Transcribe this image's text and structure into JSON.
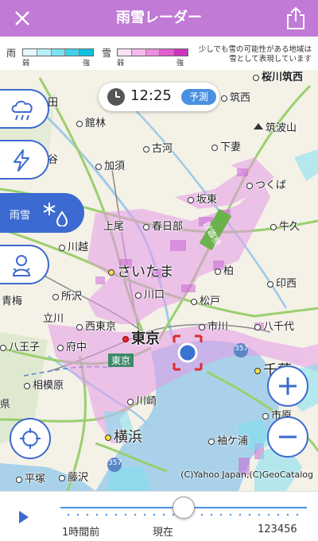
{
  "header": {
    "title": "雨雪レーダー",
    "close_icon": "close-icon",
    "share_icon": "share-icon"
  },
  "legend": {
    "rain_label": "雨",
    "snow_label": "雪",
    "weak": "弱",
    "strong": "強",
    "rain_colors": [
      "#e6f8fc",
      "#b8eef7",
      "#7fe0f0",
      "#3fd0e8",
      "#10c0de"
    ],
    "snow_colors": [
      "#fbe1f4",
      "#f5b8ea",
      "#ec8ede",
      "#de5fcf",
      "#cc33bf"
    ],
    "note_line1": "少しでも雪の可能性がある地域は",
    "note_line2": "雪として表現しています"
  },
  "time": {
    "value": "12:25",
    "badge": "予測"
  },
  "side_buttons": [
    {
      "name": "rain-cloud-icon"
    },
    {
      "name": "lightning-icon"
    },
    {
      "label": "雨雪",
      "name": "snow-rain-icon"
    },
    {
      "name": "snowman-icon"
    }
  ],
  "places": {
    "p1": "桜川筑西",
    "p2": "筑西",
    "p3": "筑波山",
    "p4": "館林",
    "p5": "古河",
    "p6": "下妻",
    "p7": "加須",
    "p8": "つくば",
    "p9": "坂東",
    "p10": "上尾",
    "p11": "春日部",
    "p12": "牛久",
    "p13": "川越",
    "p14": "常磐道",
    "p15": "さいたま",
    "p16": "柏",
    "p17": "印西",
    "p18": "所沢",
    "p19": "川口",
    "p20": "松戸",
    "p21": "青梅",
    "p22": "立川",
    "p23": "西東京",
    "p24": "市川",
    "p25": "八千代",
    "p26": "八王子",
    "p27": "府中",
    "p28": "東京",
    "p29": "東京",
    "p30": "千葉",
    "p31": "相模原",
    "p32": "川崎",
    "p33": "市原",
    "p34": "横浜",
    "p35": "袖ケ浦",
    "p36": "平塚",
    "p37": "藤沢",
    "p38": "谷",
    "p39": "県",
    "p40": "田",
    "p41": "357",
    "p42": "357"
  },
  "copyright": "(C)Yahoo Japan,(C)GeoCatalog",
  "timeline": {
    "left": "1時間前",
    "middle": "現在",
    "right": "123456",
    "progress": 0.5
  },
  "zoom": {
    "plus_icon": "plus-icon",
    "minus_icon": "minus-icon"
  },
  "location_icon": "crosshair-icon"
}
